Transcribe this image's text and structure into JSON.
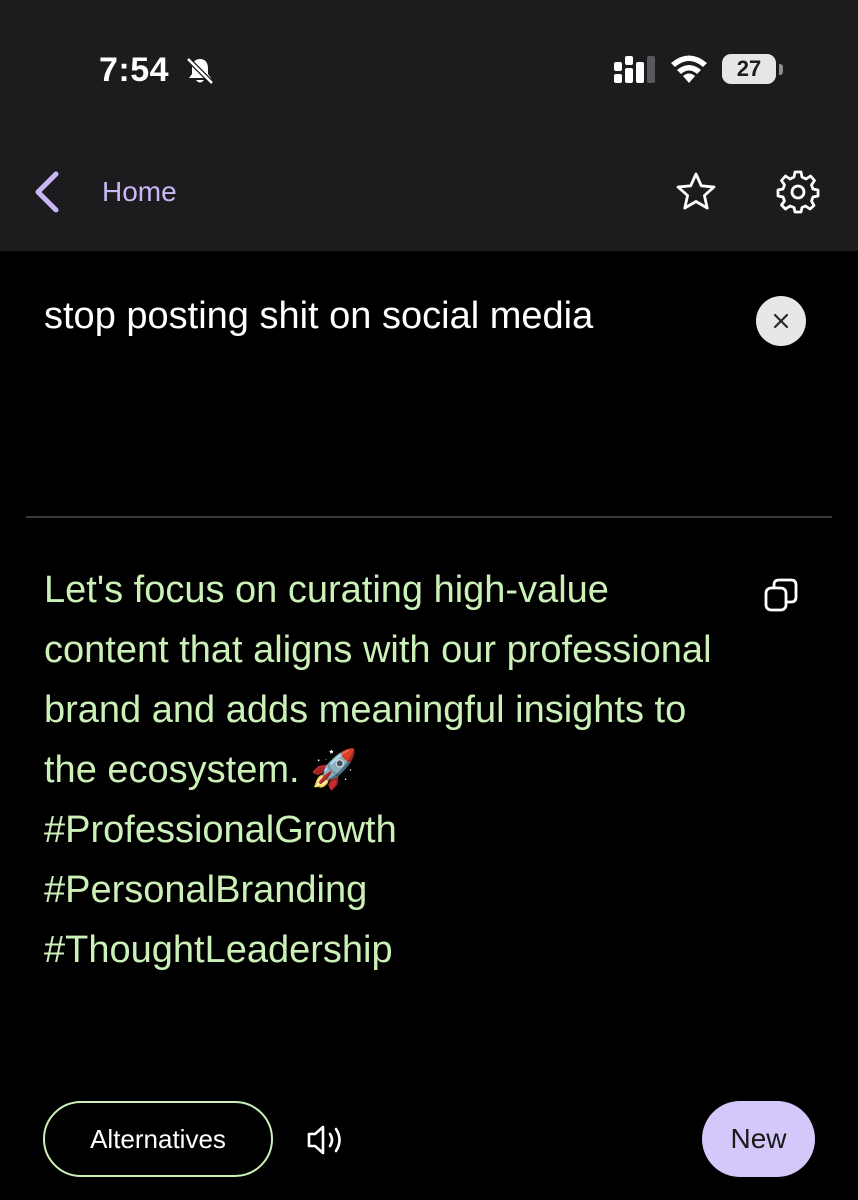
{
  "status_bar": {
    "time": "7:54",
    "battery_level": "27",
    "icons": [
      "bell-slash-icon",
      "cellular-signal-icon",
      "wifi-icon",
      "battery-icon"
    ]
  },
  "nav": {
    "back_label": "Home",
    "icons": [
      "chevron-left-icon",
      "star-icon",
      "gear-icon"
    ],
    "accent_color": "#c9b8f5"
  },
  "input": {
    "text": "stop posting shit on social media",
    "clear_icon": "close-icon"
  },
  "output": {
    "text": "Let's focus on curating high-value content that aligns with our professional brand and adds meaningful insights to the ecosystem. 🚀\n#ProfessionalGrowth\n#PersonalBranding\n#ThoughtLeadership",
    "copy_icon": "copy-icon",
    "text_color": "#cbf0b8"
  },
  "actions": {
    "alternatives_label": "Alternatives",
    "speaker_icon": "speaker-icon",
    "new_label": "New",
    "new_color": "#d4c8fb"
  }
}
